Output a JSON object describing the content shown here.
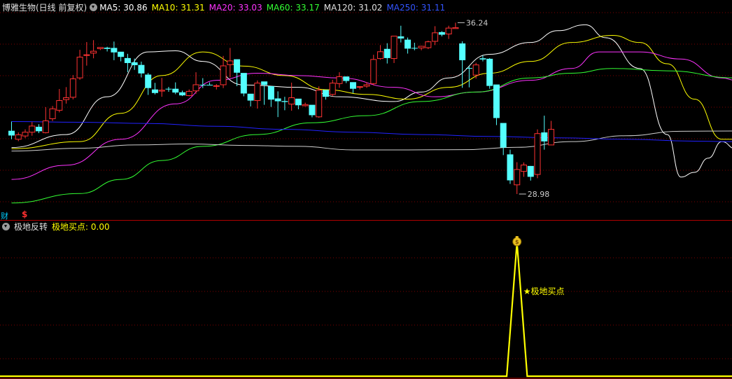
{
  "header": {
    "stock_title": "博雅生物(日线 前复权)",
    "ma": [
      {
        "label": "MA5: 30.86",
        "color": "#ffffff"
      },
      {
        "label": "MA10: 31.31",
        "color": "#ffff00"
      },
      {
        "label": "MA20: 33.03",
        "color": "#ff33ff"
      },
      {
        "label": "MA60: 33.17",
        "color": "#33ff33"
      },
      {
        "label": "MA120: 31.02",
        "color": "#e0e0e0"
      },
      {
        "label": "MA250: 31.11",
        "color": "#3333ff"
      }
    ]
  },
  "sub_header": {
    "indicator_name": "极地反转",
    "value_label": "极地买点: 0.00"
  },
  "markers": {
    "cai": "财",
    "dollar": "$"
  },
  "chart_data": {
    "type": "candlestick",
    "price_range": [
      28.0,
      37.2
    ],
    "annotations": {
      "high": "36.24",
      "low": "28.98",
      "signal_label": "★极地买点"
    },
    "candles": [
      [
        31.66,
        31.46,
        32.05,
        31.3
      ],
      [
        31.3,
        31.49,
        31.59,
        31.22
      ],
      [
        31.44,
        31.6,
        31.72,
        31.35
      ],
      [
        31.6,
        31.86,
        32.03,
        31.45
      ],
      [
        31.83,
        31.64,
        31.94,
        31.56
      ],
      [
        31.58,
        32.08,
        32.66,
        31.55
      ],
      [
        32.17,
        32.59,
        32.71,
        32.07
      ],
      [
        32.53,
        32.94,
        33.43,
        32.44
      ],
      [
        32.98,
        33.06,
        33.51,
        32.81
      ],
      [
        33.08,
        33.86,
        34.02,
        32.99
      ],
      [
        33.9,
        34.78,
        35.09,
        33.82
      ],
      [
        34.88,
        34.88,
        35.42,
        34.42
      ],
      [
        34.95,
        35.03,
        35.5,
        34.73
      ],
      [
        35.14,
        35.19,
        35.2,
        35.08
      ],
      [
        35.18,
        35.13,
        35.22,
        35.02
      ],
      [
        35.17,
        34.98,
        35.44,
        34.65
      ],
      [
        35.01,
        34.79,
        35.0,
        34.6
      ],
      [
        34.74,
        34.53,
        34.92,
        34.14
      ],
      [
        34.56,
        34.44,
        34.72,
        34.24
      ],
      [
        34.45,
        34.09,
        34.59,
        33.92
      ],
      [
        34.04,
        33.47,
        34.11,
        33.18
      ],
      [
        33.41,
        33.26,
        33.69,
        33.2
      ],
      [
        33.34,
        33.38,
        33.9,
        33.1
      ],
      [
        33.44,
        33.42,
        33.52,
        33.31
      ],
      [
        33.44,
        33.28,
        33.71,
        33.21
      ],
      [
        33.29,
        33.16,
        33.36,
        33.13
      ],
      [
        33.15,
        33.33,
        33.41,
        33.12
      ],
      [
        33.35,
        33.61,
        34.14,
        33.23
      ],
      [
        33.61,
        33.58,
        33.89,
        33.47
      ],
      [
        33.61,
        33.58,
        33.71,
        33.58
      ],
      [
        33.55,
        33.57,
        33.64,
        33.41
      ],
      [
        33.61,
        34.41,
        34.83,
        33.47
      ],
      [
        34.46,
        34.62,
        35.17,
        33.92
      ],
      [
        34.69,
        34.12,
        34.31,
        33.55
      ],
      [
        34.11,
        33.24,
        34.1,
        33.12
      ],
      [
        33.23,
        32.94,
        33.22,
        32.69
      ],
      [
        32.94,
        33.68,
        33.79,
        32.6
      ],
      [
        33.75,
        33.6,
        33.64,
        32.76
      ],
      [
        33.55,
        32.98,
        33.5,
        32.67
      ],
      [
        33.03,
        32.91,
        33.33,
        32.24
      ],
      [
        32.92,
        32.88,
        33.1,
        32.53
      ],
      [
        32.79,
        33.06,
        33.7,
        32.51
      ],
      [
        33.02,
        32.74,
        32.96,
        32.57
      ],
      [
        32.72,
        32.77,
        32.85,
        32.69
      ],
      [
        32.76,
        32.32,
        32.59,
        32.23
      ],
      [
        32.25,
        33.38,
        33.54,
        32.21
      ],
      [
        33.39,
        33.1,
        33.32,
        32.98
      ],
      [
        33.2,
        33.68,
        33.82,
        33.12
      ],
      [
        33.66,
        33.95,
        34.14,
        33.48
      ],
      [
        33.96,
        33.77,
        33.84,
        33.68
      ],
      [
        33.72,
        33.44,
        33.67,
        33.26
      ],
      [
        33.5,
        33.53,
        33.54,
        33.41
      ],
      [
        33.55,
        33.61,
        33.72,
        33.48
      ],
      [
        33.66,
        34.68,
        34.88,
        33.58
      ],
      [
        34.72,
        35.01,
        35.29,
        34.67
      ],
      [
        35.13,
        34.74,
        35.37,
        34.51
      ],
      [
        34.72,
        35.67,
        35.57,
        34.53
      ],
      [
        35.66,
        35.57,
        36.11,
        35.4
      ],
      [
        35.52,
        35.14,
        35.61,
        34.93
      ],
      [
        35.17,
        35.15,
        35.39,
        35.07
      ],
      [
        35.17,
        35.24,
        35.26,
        35.07
      ],
      [
        35.18,
        35.43,
        35.48,
        35.12
      ],
      [
        35.45,
        35.81,
        36.09,
        35.29
      ],
      [
        35.84,
        35.73,
        35.88,
        35.66
      ],
      [
        35.76,
        36.01,
        36.11,
        35.55
      ],
      [
        35.99,
        36.03,
        36.24,
        35.98
      ],
      [
        35.36,
        34.65,
        35.45,
        33.48
      ],
      [
        34.32,
        34.31,
        34.4,
        33.5
      ],
      [
        34.02,
        34.45,
        34.54,
        33.87
      ],
      [
        34.73,
        34.68,
        34.85,
        34.6
      ],
      [
        34.71,
        33.56,
        34.74,
        33.44
      ],
      [
        33.62,
        32.2,
        33.61,
        31.9
      ],
      [
        31.99,
        30.95,
        31.75,
        30.63
      ],
      [
        30.66,
        29.56,
        30.86,
        29.41
      ],
      [
        29.37,
        30.02,
        30.33,
        28.98
      ],
      [
        29.94,
        30.21,
        30.32,
        29.71
      ],
      [
        30.17,
        29.71,
        30.17,
        29.55
      ],
      [
        29.81,
        31.54,
        31.72,
        29.65
      ],
      [
        31.59,
        31.21,
        32.3,
        30.86
      ],
      [
        31.06,
        31.72,
        32.08,
        31.05
      ]
    ],
    "ma": {
      "MA5": [
        [
          0,
          30.95
        ],
        [
          8,
          31.5
        ],
        [
          14,
          33.1
        ],
        [
          20,
          35.0
        ],
        [
          24,
          35.05
        ],
        [
          28,
          34.6
        ],
        [
          34,
          33.6
        ],
        [
          42,
          33.5
        ],
        [
          48,
          33.1
        ],
        [
          56,
          32.9
        ],
        [
          60,
          33.3
        ],
        [
          64,
          33.9
        ],
        [
          70,
          34.9
        ],
        [
          76,
          35.4
        ],
        [
          80,
          35.9
        ],
        [
          84,
          36.15
        ],
        [
          87,
          35.6
        ],
        [
          92,
          34.3
        ],
        [
          96,
          31.5
        ],
        [
          98,
          29.7
        ],
        [
          100,
          29.9
        ],
        [
          102,
          30.5
        ],
        [
          104,
          31.2
        ],
        [
          106,
          30.9
        ]
      ],
      "MA10": [
        [
          0,
          30.9
        ],
        [
          10,
          31.2
        ],
        [
          16,
          32.4
        ],
        [
          22,
          34.0
        ],
        [
          28,
          35.0
        ],
        [
          34,
          34.4
        ],
        [
          40,
          34.0
        ],
        [
          46,
          33.4
        ],
        [
          52,
          33.2
        ],
        [
          58,
          33.0
        ],
        [
          64,
          33.5
        ],
        [
          70,
          34.1
        ],
        [
          76,
          34.6
        ],
        [
          82,
          35.4
        ],
        [
          88,
          35.7
        ],
        [
          92,
          35.4
        ],
        [
          96,
          34.5
        ],
        [
          100,
          33.0
        ],
        [
          104,
          31.3
        ],
        [
          106,
          31.3
        ]
      ],
      "MA20": [
        [
          0,
          29.6
        ],
        [
          8,
          30.2
        ],
        [
          16,
          31.3
        ],
        [
          24,
          32.8
        ],
        [
          30,
          33.8
        ],
        [
          36,
          34.1
        ],
        [
          42,
          34.0
        ],
        [
          48,
          33.9
        ],
        [
          56,
          33.5
        ],
        [
          62,
          33.1
        ],
        [
          68,
          33.3
        ],
        [
          76,
          33.8
        ],
        [
          82,
          34.3
        ],
        [
          86,
          35.0
        ],
        [
          92,
          35.0
        ],
        [
          98,
          34.7
        ],
        [
          104,
          33.9
        ],
        [
          106,
          33.8
        ]
      ],
      "MA60": [
        [
          0,
          28.6
        ],
        [
          10,
          29.0
        ],
        [
          16,
          29.6
        ],
        [
          22,
          30.4
        ],
        [
          28,
          31.0
        ],
        [
          36,
          31.5
        ],
        [
          44,
          32.0
        ],
        [
          52,
          32.3
        ],
        [
          60,
          32.9
        ],
        [
          68,
          33.3
        ],
        [
          76,
          33.9
        ],
        [
          82,
          34.1
        ],
        [
          88,
          34.3
        ],
        [
          96,
          34.2
        ],
        [
          106,
          33.9
        ]
      ],
      "MA120": [
        [
          0,
          30.8
        ],
        [
          10,
          30.92
        ],
        [
          18,
          31.06
        ],
        [
          26,
          31.1
        ],
        [
          34,
          31.04
        ],
        [
          42,
          31.0
        ],
        [
          50,
          30.85
        ],
        [
          58,
          30.85
        ],
        [
          66,
          30.86
        ],
        [
          74,
          30.96
        ],
        [
          82,
          31.2
        ],
        [
          90,
          31.45
        ],
        [
          98,
          31.64
        ],
        [
          106,
          31.65
        ]
      ],
      "MA250": [
        [
          0,
          32.05
        ],
        [
          10,
          32.02
        ],
        [
          20,
          31.97
        ],
        [
          30,
          31.85
        ],
        [
          40,
          31.72
        ],
        [
          50,
          31.6
        ],
        [
          60,
          31.5
        ],
        [
          70,
          31.42
        ],
        [
          80,
          31.36
        ],
        [
          90,
          31.3
        ],
        [
          100,
          31.22
        ],
        [
          106,
          31.2
        ]
      ]
    },
    "indicator": {
      "name": "极地买点",
      "signal_index": 74,
      "value_range": [
        0,
        1
      ]
    }
  }
}
